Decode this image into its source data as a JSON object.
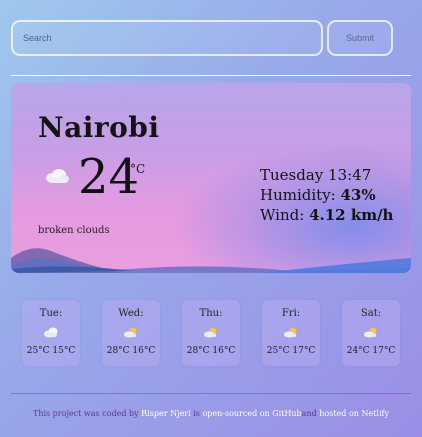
{
  "search": {
    "placeholder": "Search",
    "submit_label": "Submit"
  },
  "current": {
    "city": "Nairobi",
    "temperature": "24",
    "unit": "°C",
    "description": "broken clouds",
    "icon": "cloud-icon",
    "datetime": "Tuesday 13:47",
    "humidity_label": "Humidity:",
    "humidity_value": "43%",
    "wind_label": "Wind:",
    "wind_value": "4.12 km/h"
  },
  "forecast": [
    {
      "day": "Tue:",
      "temps": "25°C 15°C",
      "icon": "cloud-icon"
    },
    {
      "day": "Wed:",
      "temps": "28°C 16°C",
      "icon": "partly-cloudy-icon"
    },
    {
      "day": "Thu:",
      "temps": "28°C 16°C",
      "icon": "partly-cloudy-icon"
    },
    {
      "day": "Fri:",
      "temps": "25°C 17°C",
      "icon": "partly-cloudy-icon"
    },
    {
      "day": "Sat:",
      "temps": "24°C 17°C",
      "icon": "partly-cloudy-icon"
    }
  ],
  "footer": {
    "text1": "This project was coded by ",
    "author": "Risper Njeri",
    "text2": " is ",
    "source_link": "open-sourced on GitHub",
    "text3": "and ",
    "hosting_link": "hosted on Netlify"
  },
  "colors": {
    "accent": "#9a8ee6",
    "card": "#e69ae0",
    "link": "#ffffff"
  }
}
